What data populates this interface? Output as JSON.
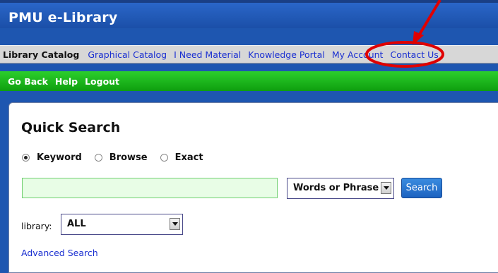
{
  "app": {
    "title": "PMU e-Library"
  },
  "nav": {
    "current": "Library Catalog",
    "items": [
      "Graphical Catalog",
      "I Need Material",
      "Knowledge Portal",
      "My Account",
      "Contact Us"
    ]
  },
  "actions": {
    "back": "Go Back",
    "help": "Help",
    "logout": "Logout"
  },
  "quick_search": {
    "title": "Quick Search",
    "modes": [
      "Keyword",
      "Browse",
      "Exact"
    ],
    "selected_mode": "Keyword",
    "query": "",
    "match_type": "Words or Phrase",
    "search_button": "Search",
    "library_label": "library:",
    "library_value": "ALL",
    "advanced_link": "Advanced Search"
  },
  "colors": {
    "header": "#1e56b0",
    "actionbar": "#1aa51a",
    "annotation": "#e00000"
  }
}
